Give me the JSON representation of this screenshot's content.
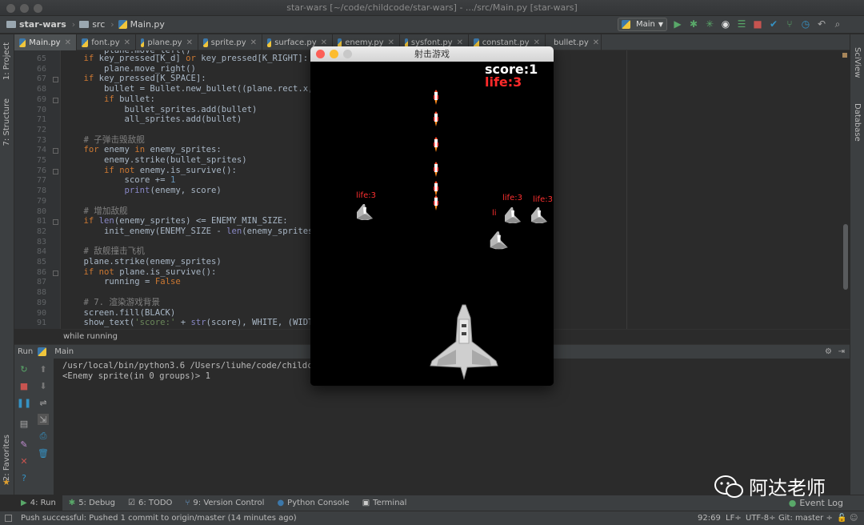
{
  "window": {
    "title": "star-wars [~/code/childcode/star-wars] - .../src/Main.py [star-wars]"
  },
  "breadcrumb": {
    "project": "star-wars",
    "folder": "src",
    "file": "Main.py"
  },
  "run_config": {
    "label": "Main"
  },
  "tabs": [
    {
      "label": "Main.py",
      "active": true
    },
    {
      "label": "font.py"
    },
    {
      "label": "plane.py"
    },
    {
      "label": "sprite.py"
    },
    {
      "label": "surface.py"
    },
    {
      "label": "enemy.py"
    },
    {
      "label": "sysfont.py"
    },
    {
      "label": "constant.py"
    },
    {
      "label": "bullet.py"
    }
  ],
  "left_panels": {
    "project": "1: Project",
    "structure": "7: Structure",
    "favorites": "2: Favorites"
  },
  "right_panels": {
    "sciview": "SciView",
    "database": "Database"
  },
  "editor": {
    "line_numbers": [
      "65",
      "66",
      "67",
      "68",
      "69",
      "70",
      "71",
      "72",
      "73",
      "74",
      "75",
      "76",
      "77",
      "78",
      "79",
      "80",
      "81",
      "82",
      "83",
      "84",
      "85",
      "86",
      "87",
      "88",
      "89",
      "90",
      "91"
    ],
    "lines": [
      "    if key_pressed[K_d] or key_pressed[K_RIGHT]:",
      "        plane.move_right()",
      "    if key_pressed[K_SPACE]:",
      "        bullet = Bullet.new_bullet((plane.rect.x, pla",
      "        if bullet:",
      "            bullet_sprites.add(bullet)",
      "            all_sprites.add(bullet)",
      "",
      "    # 子弹击毁敌舰",
      "    for enemy in enemy_sprites:",
      "        enemy.strike(bullet_sprites)",
      "        if not enemy.is_survive():",
      "            score += 1",
      "            print(enemy, score)",
      "",
      "    # 增加敌舰",
      "    if len(enemy_sprites) <= ENEMY_MIN_SIZE:",
      "        init_enemy(ENEMY_SIZE - len(enemy_sprites))",
      "",
      "    # 敌舰撞击飞机",
      "    plane.strike(enemy_sprites)",
      "    if not plane.is_survive():",
      "        running = False",
      "",
      "    # 7. 渲染游戏背景",
      "    screen.fill(BLACK)",
      "    show_text('score:' + str(score), WHITE, (WIDTH -"
    ],
    "partial_top": "        plane.move_left()",
    "context": "while running"
  },
  "run_panel": {
    "label": "Run",
    "config": "Main",
    "output": [
      "/usr/local/bin/python3.6 /Users/liuhe/code/childcode/",
      "<Enemy sprite(in 0 groups)> 1"
    ]
  },
  "game": {
    "title": "射击游戏",
    "score": "score:1",
    "life": "life:3",
    "enemy_labels": [
      "life:3",
      "life:3",
      "life:3",
      "li"
    ]
  },
  "tool_windows": [
    {
      "label": "4: Run",
      "icon": "run-icon"
    },
    {
      "label": "5: Debug",
      "icon": "debug-icon"
    },
    {
      "label": "6: TODO",
      "icon": "todo-icon"
    },
    {
      "label": "9: Version Control",
      "icon": "vcs-icon"
    },
    {
      "label": "Python Console",
      "icon": "python-icon"
    },
    {
      "label": "Terminal",
      "icon": "terminal-icon"
    }
  ],
  "event_log": "Event Log",
  "status": {
    "message": "Push successful: Pushed 1 commit to origin/master (14 minutes ago)",
    "position": "92:69",
    "line_sep": "LF÷",
    "encoding": "UTF-8÷",
    "git": "Git: master ÷"
  },
  "watermark": "阿达老师",
  "colors": {
    "ide_bg": "#2b2b2b",
    "panel": "#3c3f41",
    "keyword": "#cc7832",
    "string": "#6a8759",
    "number": "#6897bb",
    "life_red": "#ff2a2a"
  }
}
